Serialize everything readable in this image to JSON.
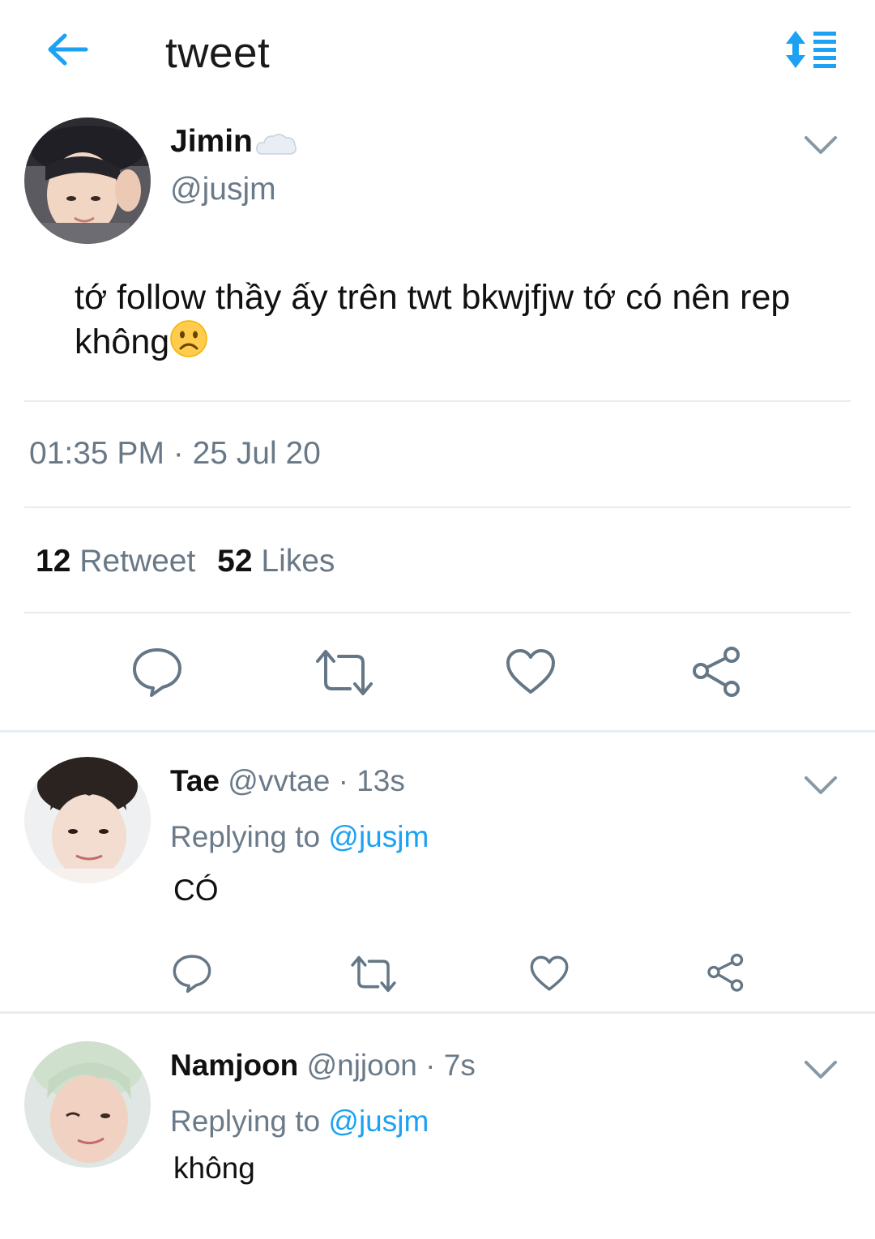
{
  "header": {
    "title": "tweet",
    "back_icon": "arrow-left-icon",
    "sort_icon": "sort-list-icon",
    "accent": "#1da1f2"
  },
  "tweet": {
    "author_name": "Jimin",
    "author_emoji": "cloud",
    "handle": "@jusjm",
    "text": "tớ follow thầy ấy trên twt bkwjfjw tớ có nên rep không",
    "text_emoji": "frowning-face",
    "timestamp": "01:35 PM · 25 Jul 20",
    "retweets": "12",
    "retweets_label": "Retweet",
    "likes": "52",
    "likes_label": "Likes"
  },
  "replies": [
    {
      "name": "Tae",
      "handle": "@vvtae",
      "time": "· 13s",
      "replying_prefix": "Replying to",
      "replying_handle": "@jusjm",
      "text": "CÓ"
    },
    {
      "name": "Namjoon",
      "handle": "@njjoon",
      "time": "· 7s",
      "replying_prefix": "Replying to",
      "replying_handle": "@jusjm",
      "text": "không"
    }
  ]
}
